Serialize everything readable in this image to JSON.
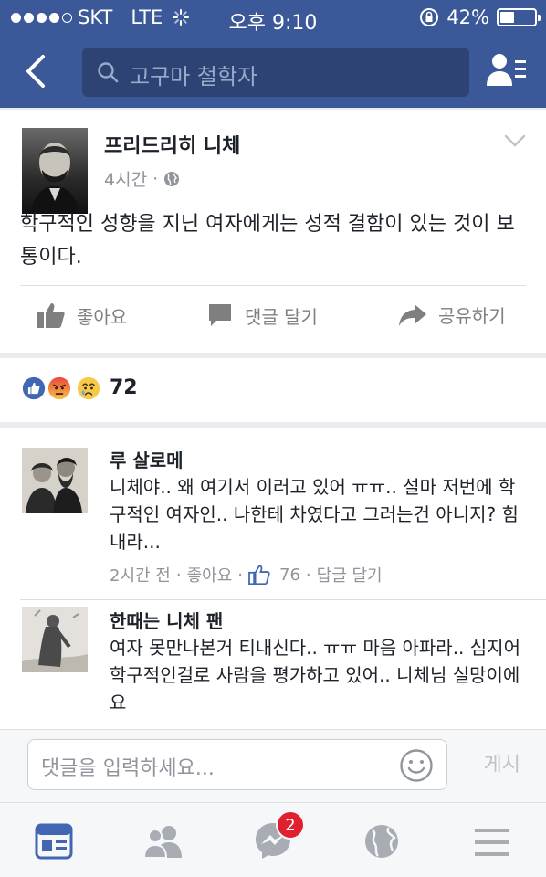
{
  "status_bar": {
    "carrier": "SKT",
    "network": "LTE",
    "time": "오후 9:10",
    "battery_percent": "42%",
    "battery_level": 0.42
  },
  "search": {
    "placeholder": "고구마 철학자"
  },
  "post": {
    "author": "프리드리히 니체",
    "time": "4시간",
    "separator": "·",
    "text": "학구적인 성향을 지닌 여자에게는 성적 결함이 있는 것이 보통이다.",
    "actions": {
      "like": "좋아요",
      "comment": "댓글 달기",
      "share": "공유하기"
    }
  },
  "reactions": {
    "count": "72"
  },
  "comments": [
    {
      "name": "루 살로메",
      "text": "니체야.. 왜 여기서 이러고 있어 ㅠㅠ.. 설마 저번에 학구적인 여자인.. 나한테 차였다고 그러는건 아니지? 힘내라...",
      "time": "2시간 전",
      "like": "좋아요",
      "likes": "76",
      "reply": "답글 달기"
    },
    {
      "name": "한때는 니체 팬",
      "text": "여자 못만나본거 티내신다.. ㅠㅠ 마음 아파라.. 심지어 학구적인걸로 사람을 평가하고 있어.. 니체님 실망이에요"
    }
  ],
  "composer": {
    "placeholder": "댓글을 입력하세요...",
    "post_label": "게시"
  },
  "tabbar": {
    "messenger_badge": "2"
  },
  "colors": {
    "brand": "#3b5998",
    "like_blue": "#4267b2",
    "badge_red": "#e0202f"
  }
}
